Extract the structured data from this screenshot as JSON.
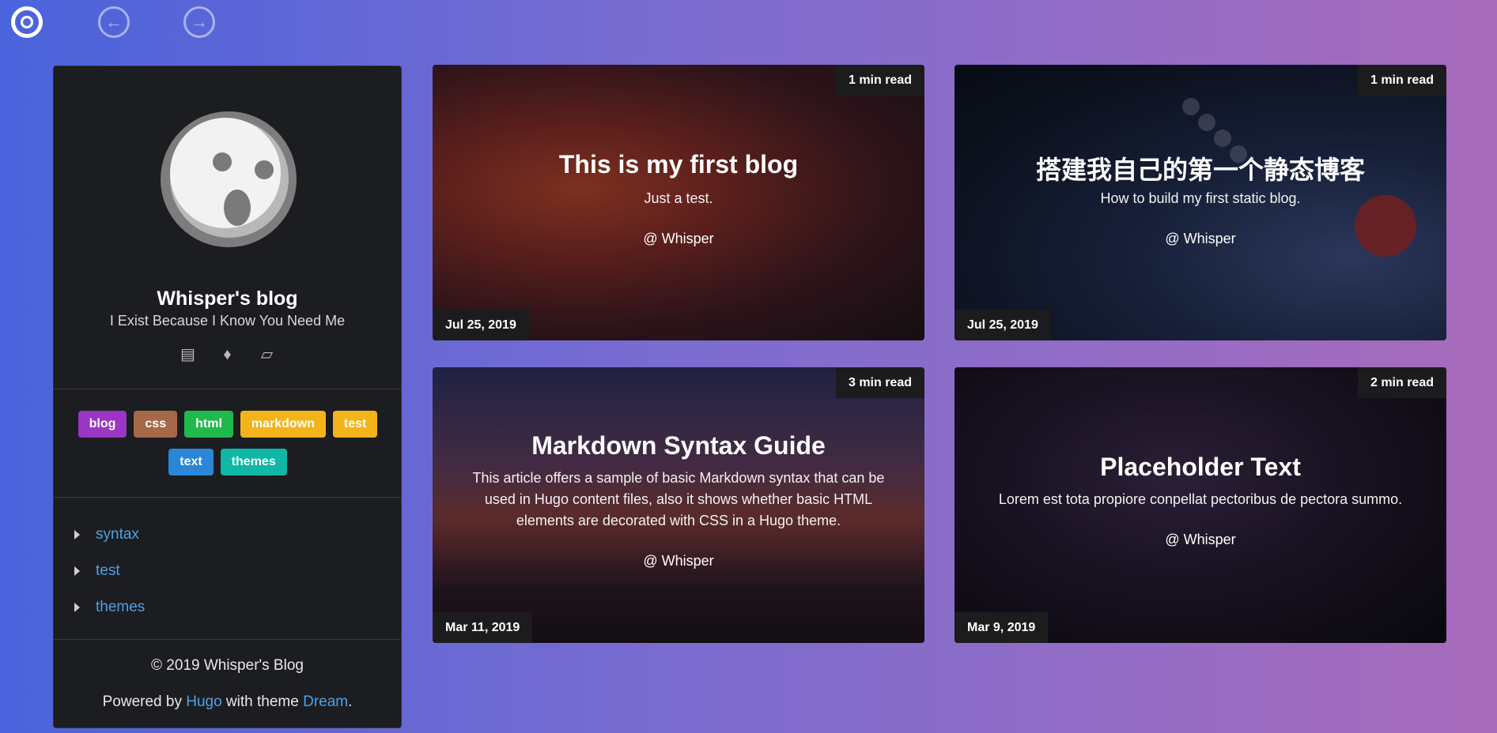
{
  "nav": {
    "home_icon": "target-icon",
    "back_icon": "arrow-left-icon",
    "forward_icon": "arrow-right-icon"
  },
  "sidebar": {
    "title": "Whisper's blog",
    "subtitle": "I Exist Because I Know You Need Me",
    "icons": [
      "archive-icon",
      "tags-icon",
      "cube-icon"
    ],
    "tags": [
      {
        "label": "blog",
        "color": "#9b35c3"
      },
      {
        "label": "css",
        "color": "#a5694a"
      },
      {
        "label": "html",
        "color": "#21b84c"
      },
      {
        "label": "markdown",
        "color": "#f2b41a"
      },
      {
        "label": "test",
        "color": "#f2b41a"
      },
      {
        "label": "text",
        "color": "#2a86d6"
      },
      {
        "label": "themes",
        "color": "#10b6a6"
      }
    ],
    "categories": [
      "syntax",
      "test",
      "themes"
    ],
    "footer": {
      "copyright": "© 2019 Whisper's Blog",
      "powered_prefix": "Powered by ",
      "hugo": "Hugo",
      "with_theme": " with theme ",
      "dream": "Dream",
      "period": "."
    }
  },
  "posts": [
    {
      "title": "This is my first blog",
      "description": "Just a test.",
      "author": "@ Whisper",
      "read_time": "1 min read",
      "date": "Jul 25, 2019"
    },
    {
      "title": "搭建我自己的第一个静态博客",
      "description": "How to build my first static blog.",
      "author": "@ Whisper",
      "read_time": "1 min read",
      "date": "Jul 25, 2019"
    },
    {
      "title": "Markdown Syntax Guide",
      "description": "This article offers a sample of basic Markdown syntax that can be used in Hugo content files, also it shows whether basic HTML elements are decorated with CSS in a Hugo theme.",
      "author": "@ Whisper",
      "read_time": "3 min read",
      "date": "Mar 11, 2019"
    },
    {
      "title": "Placeholder Text",
      "description": "Lorem est tota propiore conpellat pectoribus de pectora summo.",
      "author": "@ Whisper",
      "read_time": "2 min read",
      "date": "Mar 9, 2019"
    }
  ]
}
